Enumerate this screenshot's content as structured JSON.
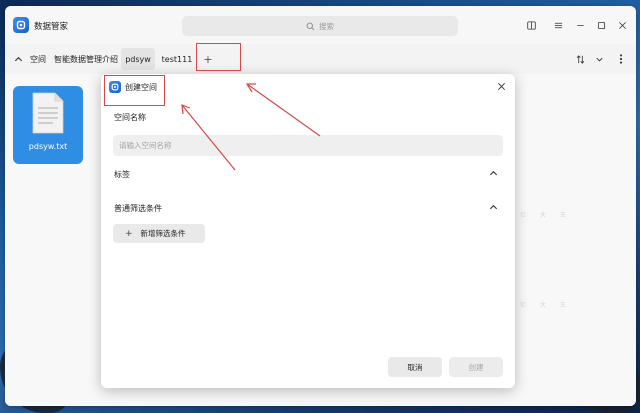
{
  "app": {
    "title": "数据管家",
    "search_placeholder": "搜索"
  },
  "tabs": {
    "header": "空间",
    "items": [
      {
        "label": "智能数据管理介绍"
      },
      {
        "label": "pdsyw"
      },
      {
        "label": "test111"
      }
    ],
    "add_label": "+"
  },
  "files": [
    {
      "name": "pdsyw.txt"
    }
  ],
  "dialog": {
    "title": "创建空间",
    "name_label": "空间名称",
    "name_placeholder": "请输入空间名称",
    "tags_label": "标签",
    "filter_label": "普通筛选条件",
    "add_filter_label": "新增筛选条件",
    "cancel_label": "取消",
    "create_label": "创建"
  },
  "colors": {
    "accent": "#2f8de4",
    "annotation": "#d9474a"
  }
}
